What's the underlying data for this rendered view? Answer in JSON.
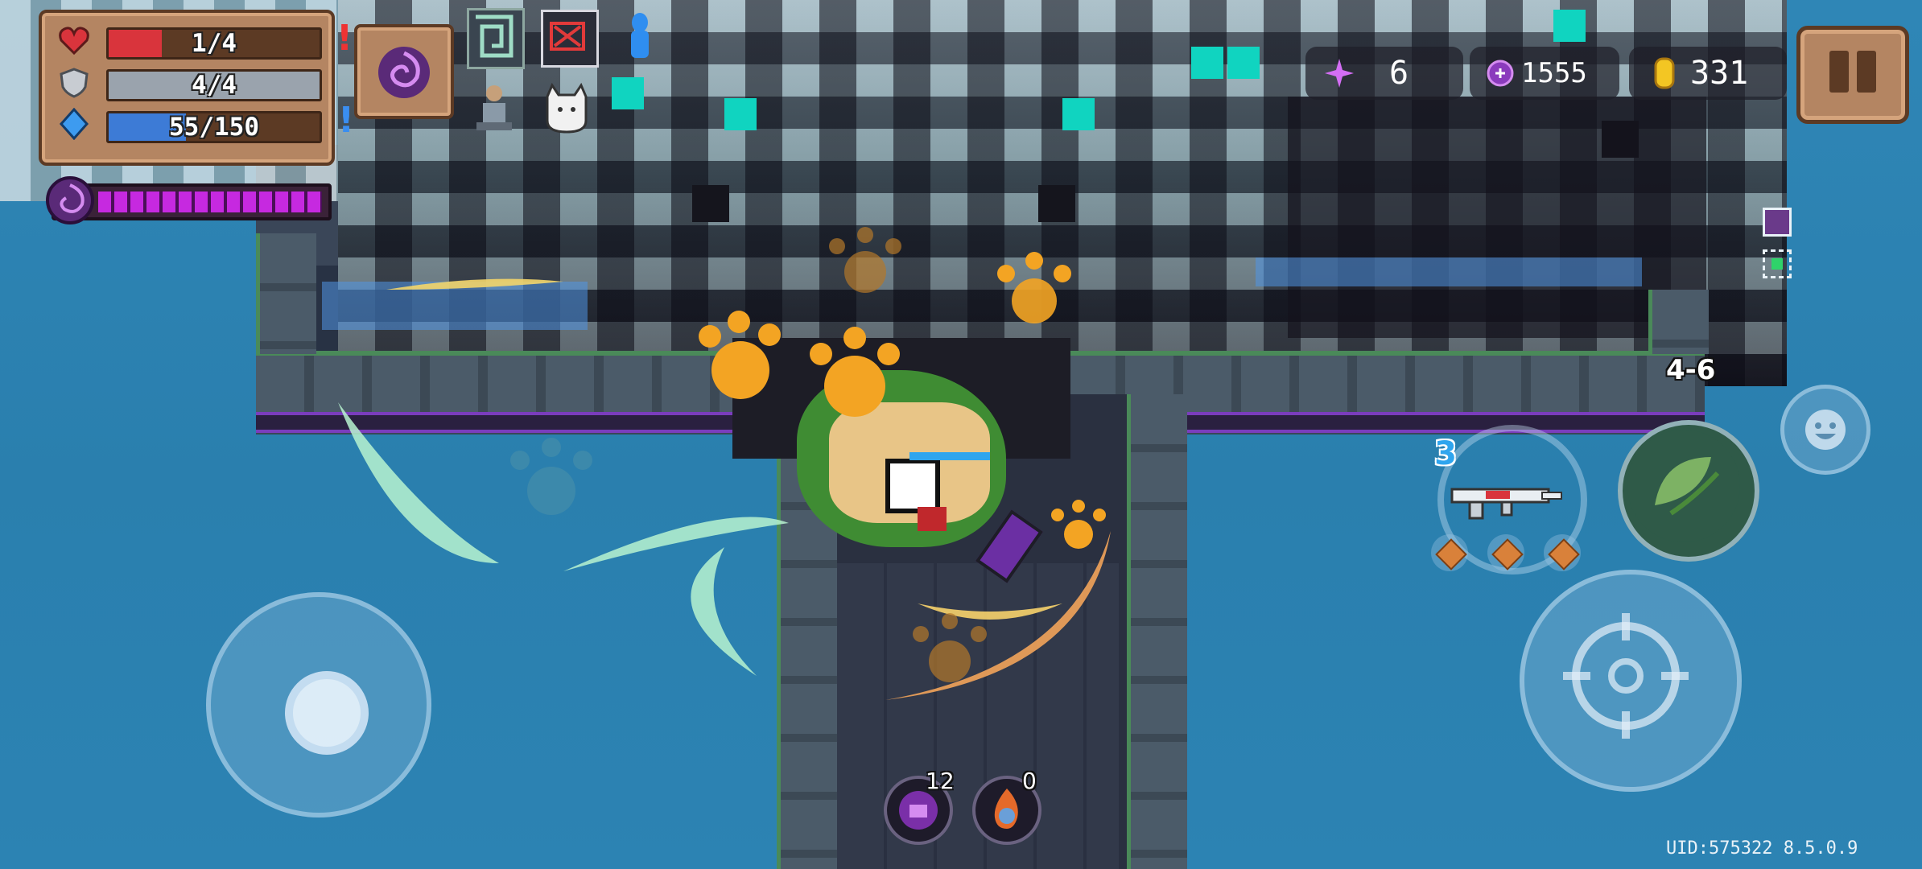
{
  "hud": {
    "hp": {
      "text": "1/4",
      "current": 1,
      "max": 4,
      "color": "#d9343c"
    },
    "armor": {
      "text": "4/4",
      "current": 4,
      "max": 4,
      "color": "#9aa3ad"
    },
    "energy": {
      "text": "55/150",
      "current": 55,
      "max": 150,
      "color": "#3d7bd6"
    },
    "alert_top": "!",
    "alert_bottom": "!",
    "boss_health_fraction": 1.0
  },
  "currencies": {
    "gems_pink": "6",
    "tokens": "1555",
    "gold": "331"
  },
  "level": {
    "label": "4-6"
  },
  "weapon": {
    "ammo_badge": "3",
    "name_icon": "rifle-icon"
  },
  "potions": [
    {
      "icon": "purple-potion-icon",
      "count": "12"
    },
    {
      "icon": "fire-potion-icon",
      "count": "0"
    }
  ],
  "footer": {
    "uid": "UID:575322 8.5.0.9"
  },
  "colors": {
    "panel": "#b48562",
    "panel_border": "#5c3a24",
    "accent_purple": "#c629e0",
    "gold": "#f3c623",
    "water": "#2a7fae"
  }
}
